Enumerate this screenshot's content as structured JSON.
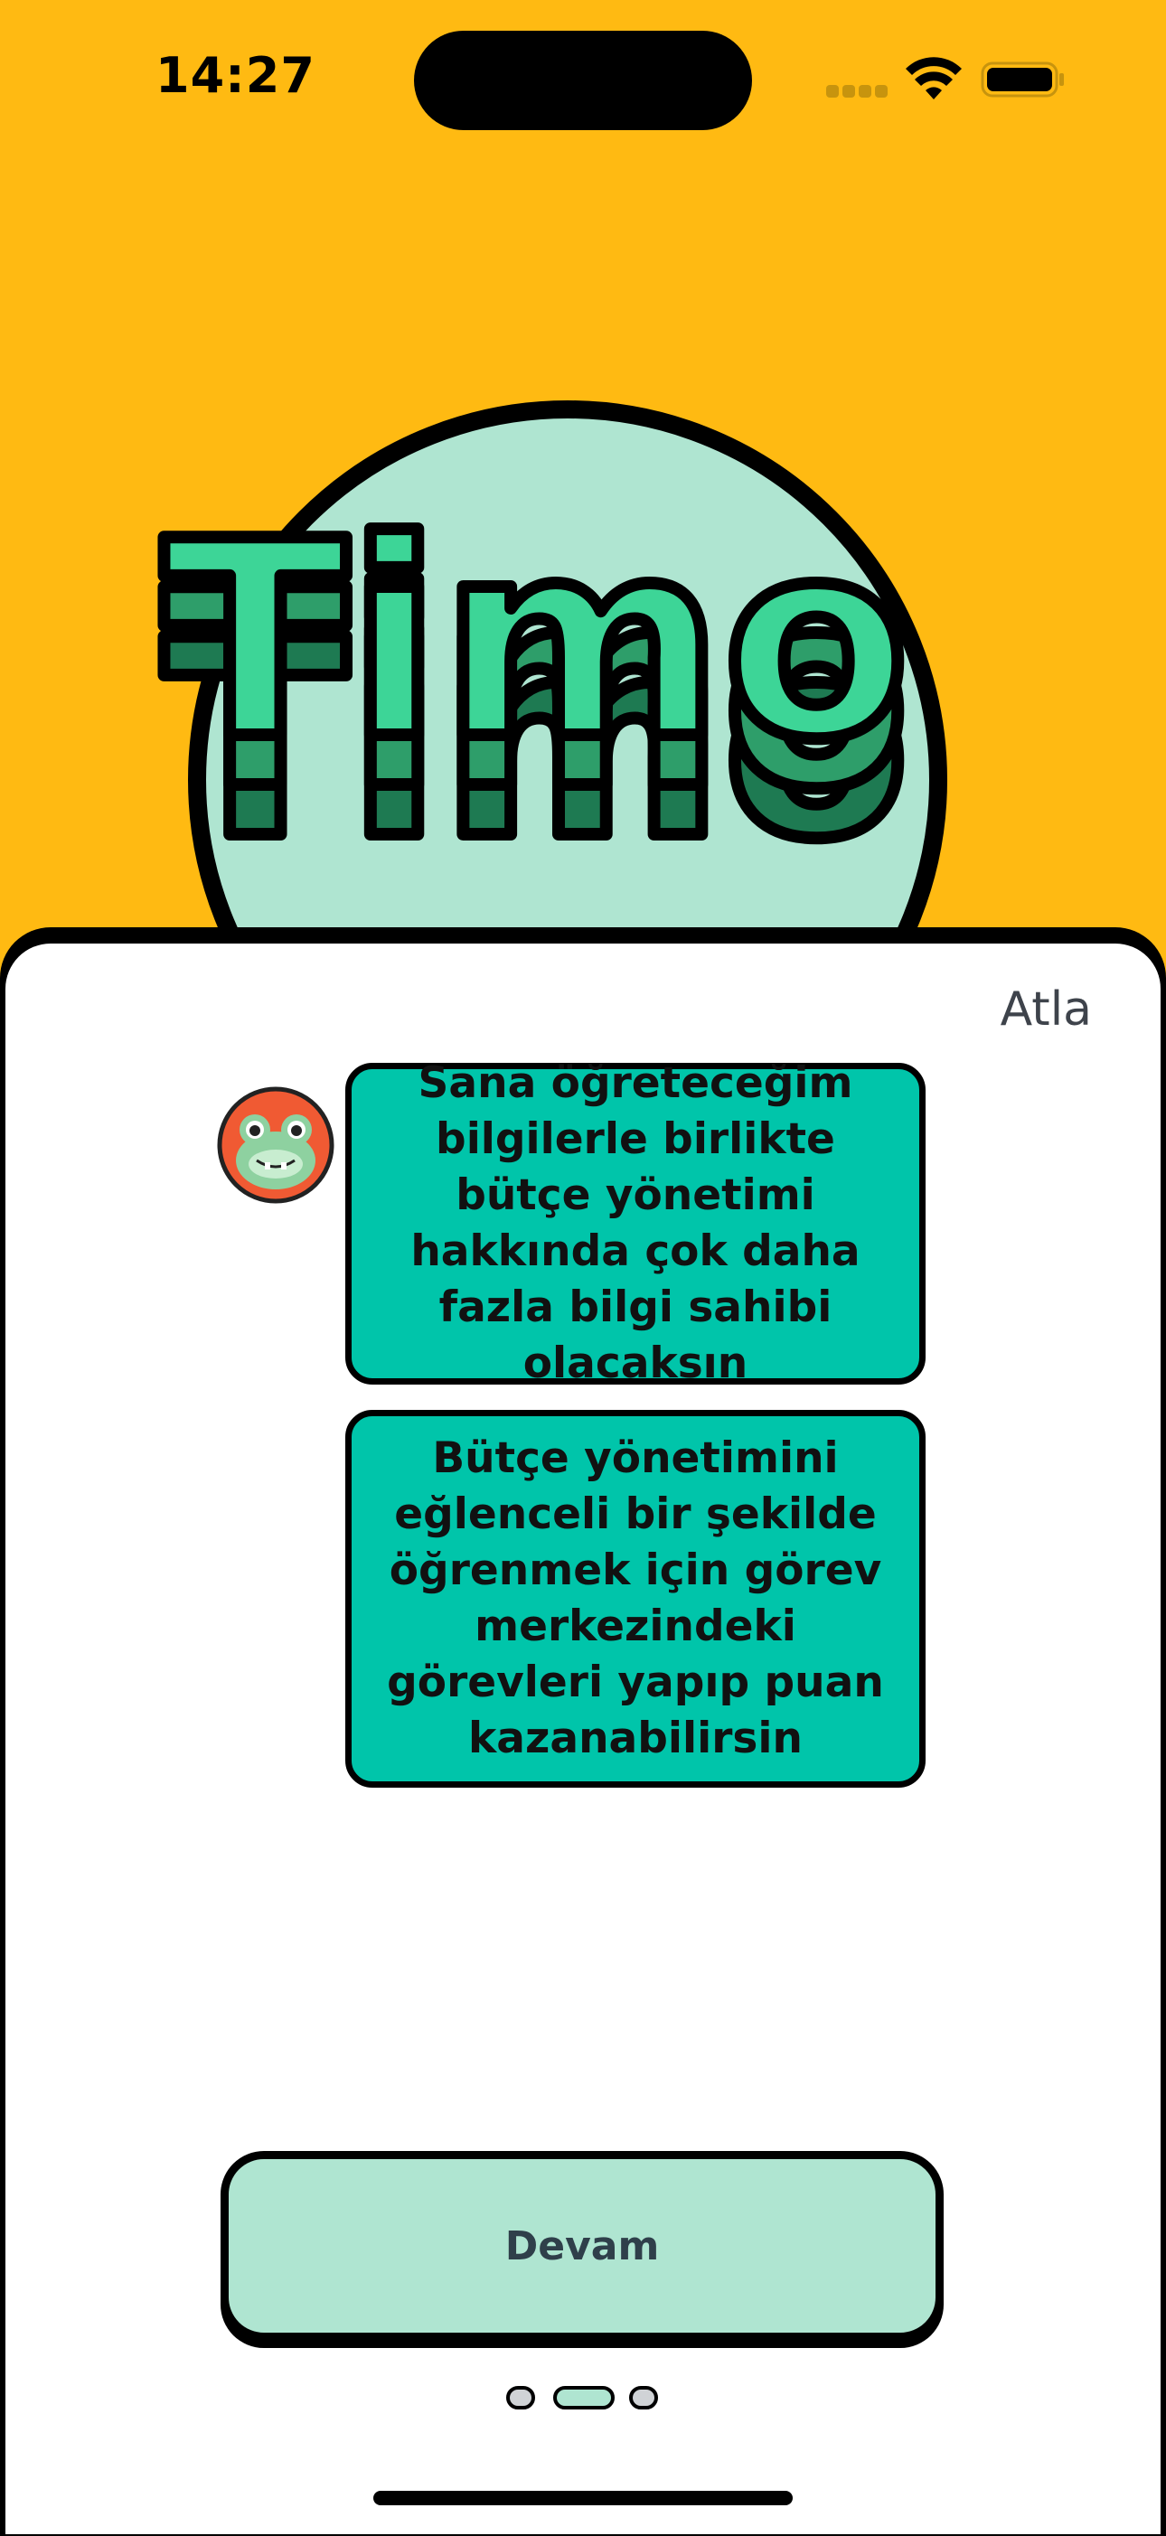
{
  "status_bar": {
    "time": "14:27",
    "icons": [
      "cellular-signal-icon",
      "wifi-icon",
      "battery-icon"
    ]
  },
  "logo": {
    "text": "Timo"
  },
  "header": {
    "skip_label": "Atla"
  },
  "chat": {
    "avatar": "frog-mascot-icon",
    "messages": [
      "Sana öğreteceğim bilgilerle birlikte bütçe yönetimi hakkında çok daha fazla bilgi sahibi olacaksın",
      "Bütçe yönetimini eğlenceli bir şekilde öğrenmek için görev merkezindeki görevleri yapıp puan kazanabilirsin"
    ]
  },
  "footer": {
    "continue_label": "Devam",
    "pagination": {
      "total": 3,
      "active_index": 1
    }
  },
  "colors": {
    "background": "#FFBA12",
    "bubble": "#00C5AA",
    "button": "#AFE5D1",
    "logo_green": "#3DD597",
    "logo_dark_green": "#1E7A52",
    "circle": "#AFE5D1",
    "avatar_bg": "#F05A33"
  }
}
